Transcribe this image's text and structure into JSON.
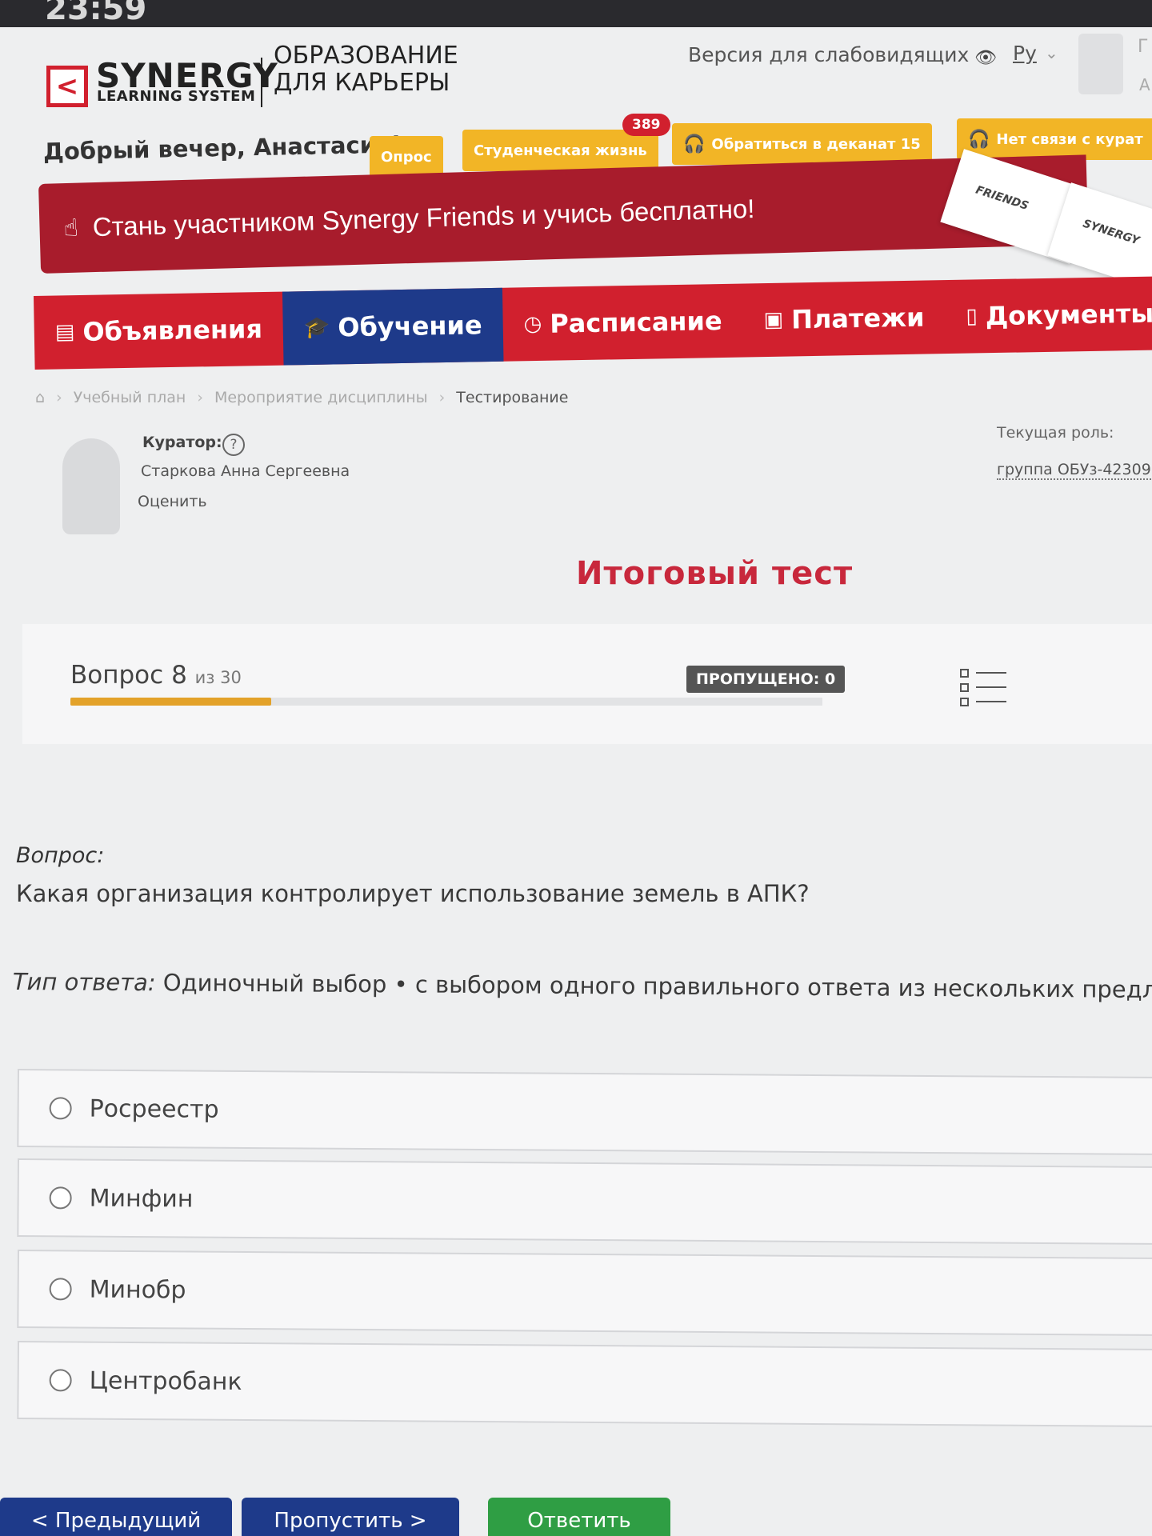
{
  "status": {
    "time": "23:59"
  },
  "header": {
    "brand": "SYNERGY",
    "brand_sub": "LEARNING SYSTEM",
    "tagline_1": "ОБРАЗОВАНИЕ",
    "tagline_2": "ДЛЯ КАРЬЕРЫ",
    "accessibility_link": "Версия для слабовидящих",
    "language": "Ру",
    "user_edge_1": "Г",
    "user_edge_2": "А"
  },
  "greeting": "Добрый вечер, Анастасия!",
  "chips": {
    "survey": "Опрос",
    "student_life": "Студенческая жизнь",
    "student_life_badge": "389",
    "dean": "Обратиться в деканат 15",
    "curator": "Нет связи с курат"
  },
  "promo": {
    "text": "Стань участником Synergy Friends и учись бесплатно!",
    "card_1": "FRIENDS",
    "card_2": "SYNERGY"
  },
  "nav": {
    "items": [
      {
        "label": "Объявления",
        "icon": "announcements-icon"
      },
      {
        "label": "Обучение",
        "icon": "graduation-cap-icon"
      },
      {
        "label": "Расписание",
        "icon": "clock-icon"
      },
      {
        "label": "Платежи",
        "icon": "payment-icon"
      },
      {
        "label": "Документы",
        "icon": "document-icon"
      }
    ]
  },
  "breadcrumb": {
    "items": [
      "Учебный план",
      "Мероприятие дисциплины",
      "Тестирование"
    ]
  },
  "curator": {
    "label": "Куратор:",
    "name": "Старкова Анна Сергеевна",
    "rate": "Оценить"
  },
  "role": {
    "label": "Текущая роль:",
    "value": "группа ОБУз-42309"
  },
  "test": {
    "title": "Итоговый тест",
    "question_label": "Вопрос",
    "question_number": "8",
    "of_label": "из 30",
    "progress": 0.267,
    "skipped": "ПРОПУЩЕНО: 0"
  },
  "question": {
    "label": "Вопрос:",
    "text": "Какая организация контролирует использование земель в АПК?",
    "type_label": "Тип ответа:",
    "type_value": "Одиночный выбор • с выбором одного правильного ответа из нескольких предложенных"
  },
  "options": [
    "Росреестр",
    "Минфин",
    "Минобр",
    "Центробанк"
  ],
  "buttons": {
    "prev": "< Предыдущий",
    "skip": "Пропустить >",
    "answer": "Ответить"
  },
  "colors": {
    "brand_red": "#d1202e",
    "active_nav": "#1e3a8a",
    "chip_yellow": "#f2b526",
    "progress": "#e3a22a",
    "answer_green": "#2f9e44"
  }
}
